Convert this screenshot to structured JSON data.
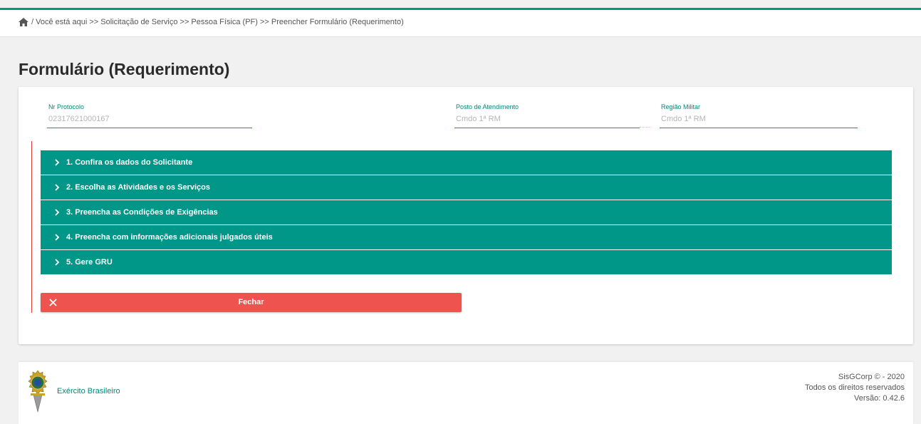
{
  "breadcrumb": {
    "home_icon": "home-icon",
    "text": "/ Você está aqui >> Solicitação de Serviço >> Pessoa Física (PF) >> Preencher Formulário (Requerimento)"
  },
  "page": {
    "title": "Formulário (Requerimento)"
  },
  "form": {
    "protocolo": {
      "label": "Nr Protocolo",
      "value": "02317621000167"
    },
    "posto": {
      "label": "Posto de Atendimento",
      "value": "Cmdo 1ª RM"
    },
    "regiao": {
      "label": "Região Militar",
      "value": "Cmdo 1ª RM"
    }
  },
  "panels": [
    {
      "label": "1. Confira os dados do Solicitante"
    },
    {
      "label": "2. Escolha as Atividades e os Serviços"
    },
    {
      "label": "3. Preencha as Condições de Exigências"
    },
    {
      "label": "4. Preencha com informações adicionais julgados úteis"
    },
    {
      "label": "5. Gere GRU"
    }
  ],
  "actions": {
    "close_label": "Fechar",
    "close_icon": "close-icon"
  },
  "footer": {
    "org": "Exército Brasileiro",
    "copyright": "SisGCorp © - 2020",
    "rights": "Todos os direitos reservados",
    "version": "Versão: 0.42.6"
  },
  "colors": {
    "accent": "#009688",
    "danger": "#ef5350",
    "label": "#00897b",
    "background": "#f1f1f1"
  }
}
